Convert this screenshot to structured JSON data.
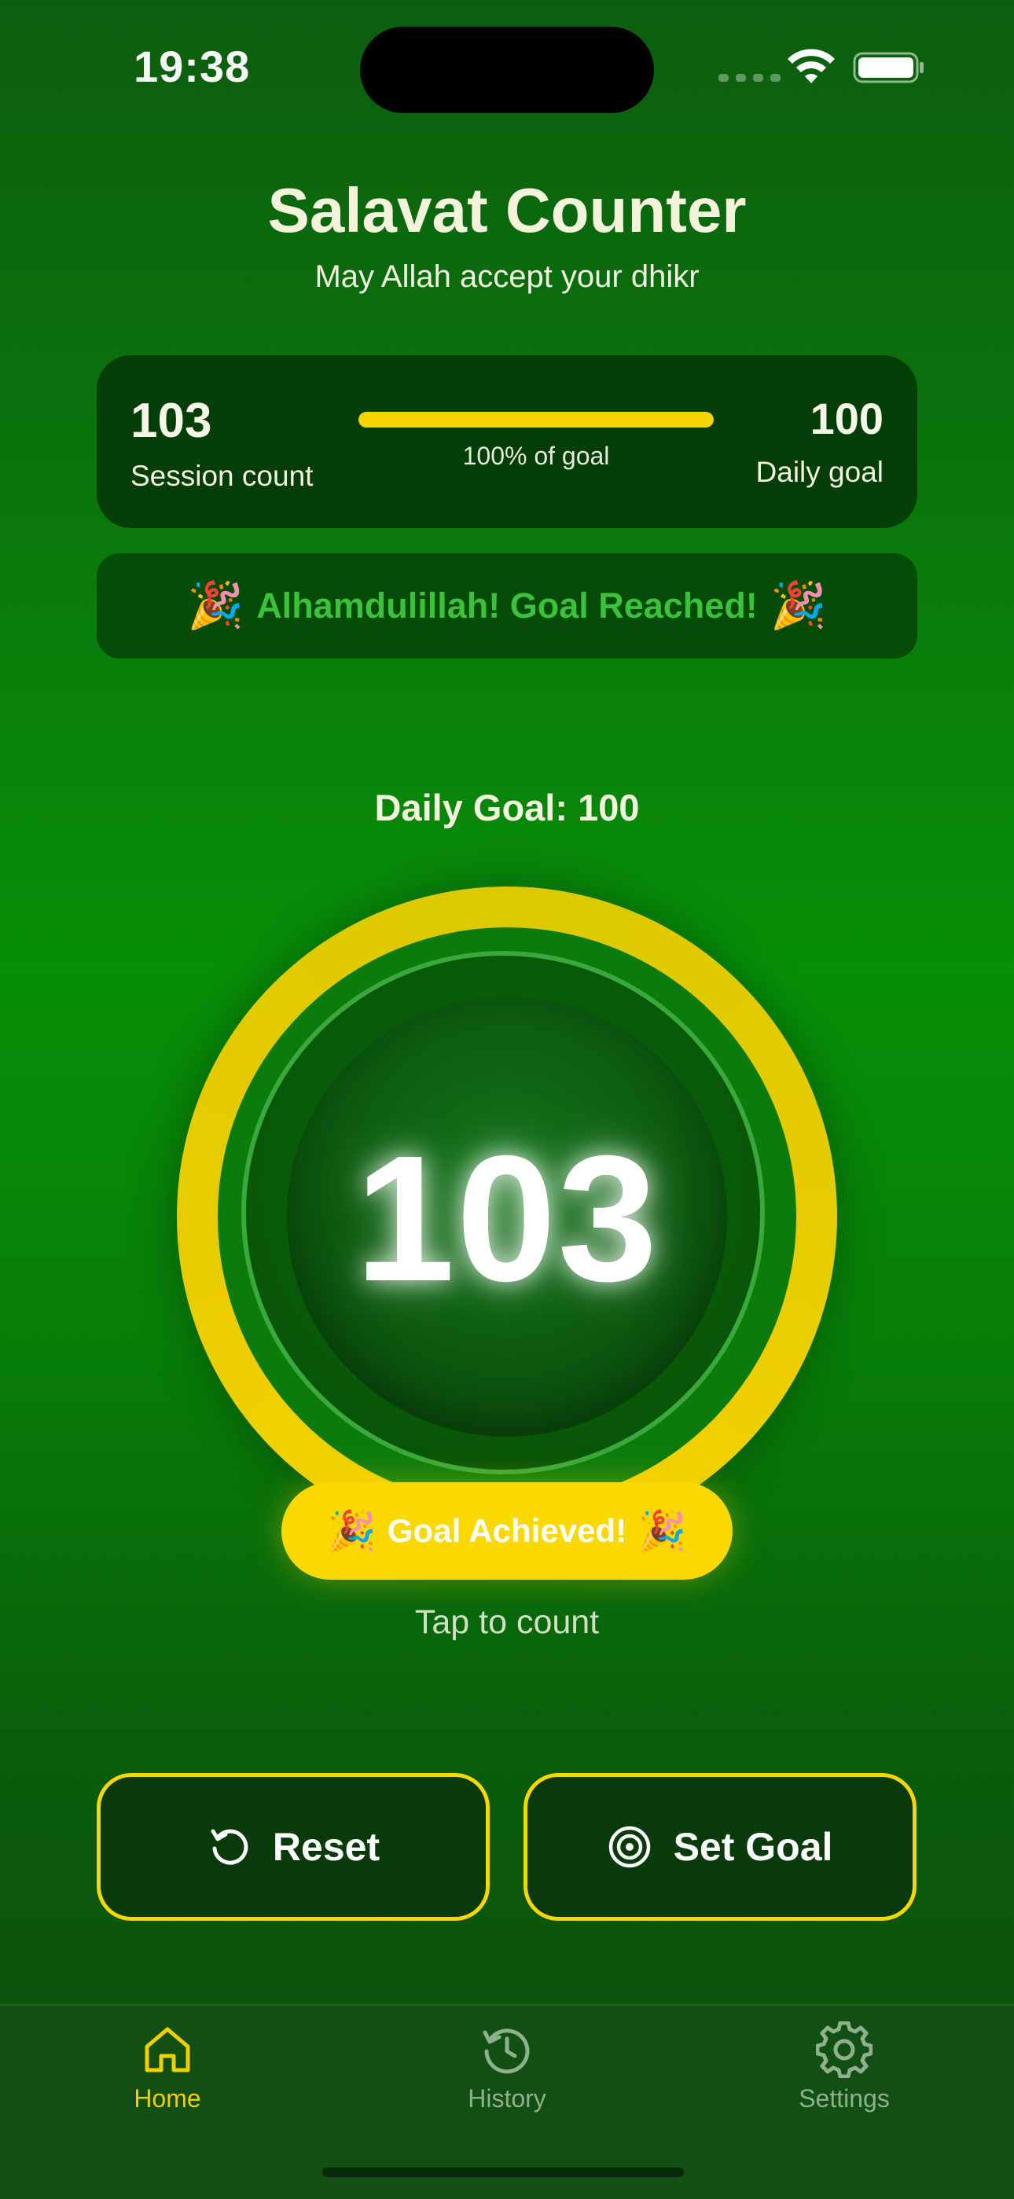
{
  "status_bar": {
    "time": "19:38"
  },
  "header": {
    "title": "Salavat Counter",
    "subtitle": "May Allah accept your dhikr"
  },
  "session_card": {
    "session_count": "103",
    "session_label": "Session count",
    "progress_label": "100% of goal",
    "progress_fraction": 1.0,
    "goal_value": "100",
    "goal_label": "Daily goal"
  },
  "banner": {
    "text": "Alhamdulillah! Goal Reached!",
    "icon": "party-popper-icon"
  },
  "counter": {
    "daily_goal_text": "Daily Goal: 100",
    "count": "103",
    "ring_progress_fraction": 1.0,
    "achieved_text": "Goal Achieved!",
    "tap_hint": "Tap to count"
  },
  "buttons": {
    "reset_label": "Reset",
    "set_goal_label": "Set Goal"
  },
  "tab_bar": {
    "items": [
      {
        "label": "Home",
        "icon": "home-icon",
        "active": true
      },
      {
        "label": "History",
        "icon": "history-icon",
        "active": false
      },
      {
        "label": "Settings",
        "icon": "gear-icon",
        "active": false
      }
    ]
  },
  "colors": {
    "background": "#078f08",
    "accent_yellow": "#f8d400",
    "banner_text": "#3cc13c",
    "active_tab": "#f0d000",
    "inactive_tab": "#8fb08f"
  }
}
